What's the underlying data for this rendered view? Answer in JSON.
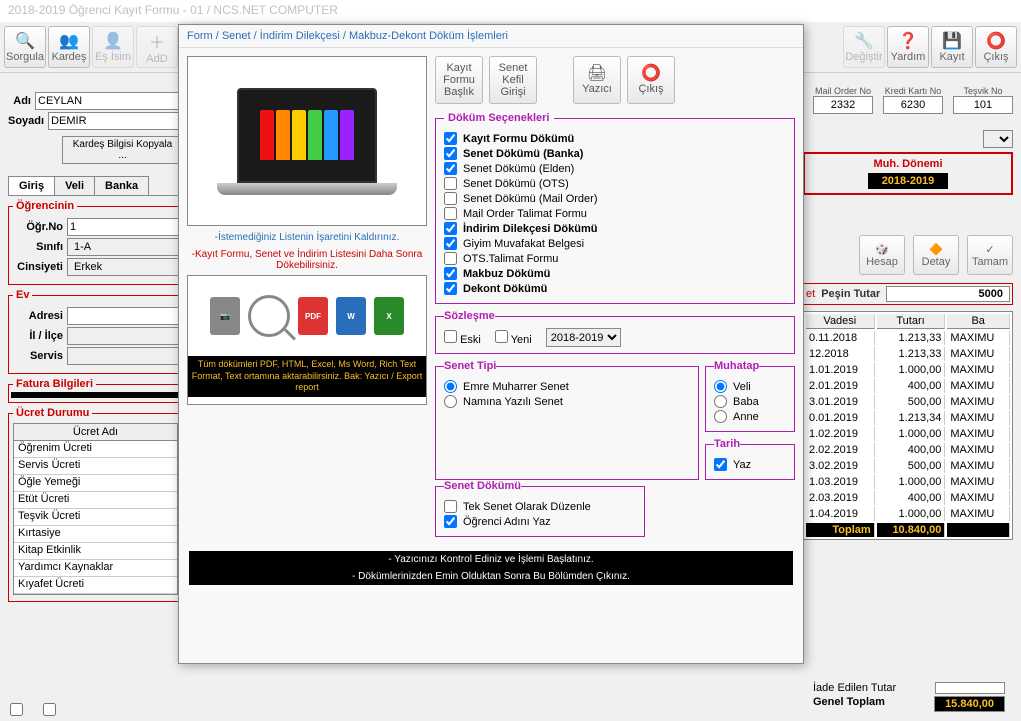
{
  "window_title": "2018-2019 Öğrenci Kayıt Formu - 01 / NCS.NET COMPUTER",
  "main_toolbar": [
    "Sorgula",
    "Kardeş",
    "Eş İsim",
    "AdD",
    "",
    "Değiştir",
    "Yardım",
    "Kayıt",
    "Çıkış"
  ],
  "main_toolbar_icons": [
    "🔍",
    "👥",
    "👤",
    "+",
    "",
    "🔧",
    "❓",
    "💾",
    "⭕"
  ],
  "form": {
    "adi_label": "Adı",
    "adi": "CEYLAN",
    "soyadi_label": "Soyadı",
    "soyadi": "DEMİR",
    "kardes_btn": "Kardeş Bilgisi Kopyala ...",
    "tabs": [
      "Giriş",
      "Veli",
      "Banka"
    ],
    "ogrencinin": "Öğrencinin",
    "ogr_no_label": "Öğr.No",
    "ogr_no": "1",
    "sinifi_label": "Sınıfı",
    "sinifi": "1-A",
    "cinsiyeti_label": "Cinsiyeti",
    "cinsiyeti": "Erkek",
    "ev": "Ev",
    "adresi": "Adresi",
    "il_ilce": "İl / İlçe",
    "servis": "Servis",
    "fatura": "Fatura Bilgileri",
    "ucret_durumu": "Ücret Durumu",
    "ucret_header": "Ücret Adı",
    "ucret_list": [
      "Öğrenim Ücreti",
      "Servis Ücreti",
      "Öğle Yemeği",
      "Etüt Ücreti",
      "Teşvik Ücreti",
      "Kırtasiye",
      "Kitap Etkinlik",
      "Yardımcı Kaynaklar",
      "Kıyafet Ücreti"
    ]
  },
  "top_right": {
    "mail_order_label": "Mail Order No",
    "mail_order": "2332",
    "kredi_label": "Kredi Kartı No",
    "kredi": "6230",
    "tesvik_label": "Teşvik No",
    "tesvik": "101",
    "muh_donemi_label": "Muh. Dönemi",
    "muh_donemi": "2018-2019",
    "hesap": "Hesap",
    "detay": "Detay",
    "tamam": "Tamam",
    "pesin_label": "Peşin Tutar",
    "pesin": "5000"
  },
  "table": {
    "headers": [
      "Vadesi",
      "Tutarı",
      "Ba"
    ],
    "rows": [
      [
        "0.11.2018",
        "1.213,33",
        "MAXIMU"
      ],
      [
        "12.2018",
        "1.213,33",
        "MAXIMU"
      ],
      [
        "1.01.2019",
        "1.000,00",
        "MAXIMU"
      ],
      [
        "2.01.2019",
        "400,00",
        "MAXIMU"
      ],
      [
        "3.01.2019",
        "500,00",
        "MAXIMU"
      ],
      [
        "0.01.2019",
        "1.213,34",
        "MAXIMU"
      ],
      [
        "1.02.2019",
        "1.000,00",
        "MAXIMU"
      ],
      [
        "2.02.2019",
        "400,00",
        "MAXIMU"
      ],
      [
        "3.02.2019",
        "500,00",
        "MAXIMU"
      ],
      [
        "1.03.2019",
        "1.000,00",
        "MAXIMU"
      ],
      [
        "2.03.2019",
        "400,00",
        "MAXIMU"
      ],
      [
        "1.04.2019",
        "1.000,00",
        "MAXIMU"
      ]
    ],
    "total_label": "Toplam",
    "total": "10.840,00",
    "iade_label": "İade Edilen Tutar",
    "genel_label": "Genel Toplam",
    "genel": "15.840,00"
  },
  "modal": {
    "title": "Form / Senet / İndirim Dilekçesi / Makbuz-Dekont Döküm İşlemleri",
    "btns": [
      {
        "l1": "Kayıt",
        "l2": "Formu",
        "l3": "Başlık"
      },
      {
        "l1": "Senet",
        "l2": "Kefil",
        "l3": "Girişi"
      },
      {
        "l1": "",
        "l2": "Yazıcı",
        "l3": "",
        "ic": "🖨"
      },
      {
        "l1": "",
        "l2": "Çıkış",
        "l3": "",
        "ic": "⭕"
      }
    ],
    "note_blue": "-İstemediğiniz Listenin İşaretini Kaldırınız.",
    "note_red": "-Kayıt Formu, Senet ve İndirim Listesini Daha Sonra Dökebilirsiniz.",
    "caption": "Tüm dökümleri PDF, HTML, Excel, Ms Word, Rich Text Format, Text ortamına aktarabilirsiniz. Bak: Yazıcı / Export report",
    "dokum_label": "Döküm Seçenekleri",
    "dokum": [
      {
        "t": "Kayıt Formu Dökümü",
        "c": true,
        "b": true
      },
      {
        "t": "Senet Dökümü (Banka)",
        "c": true,
        "b": true
      },
      {
        "t": "Senet Dökümü (Elden)",
        "c": true,
        "b": false
      },
      {
        "t": "Senet Dökümü (OTS)",
        "c": false,
        "b": false
      },
      {
        "t": "Senet Dökümü (Mail Order)",
        "c": false,
        "b": false
      },
      {
        "t": "Mail Order Talimat Formu",
        "c": false,
        "b": false
      },
      {
        "t": "İndirim Dilekçesi Dökümü",
        "c": true,
        "b": true
      },
      {
        "t": "Giyim Muvafakat Belgesi",
        "c": true,
        "b": false
      },
      {
        "t": "OTS.Talimat Formu",
        "c": false,
        "b": false
      },
      {
        "t": "Makbuz Dökümü",
        "c": true,
        "b": true
      },
      {
        "t": "Dekont Dökümü",
        "c": true,
        "b": true
      }
    ],
    "sozlesme_label": "Sözleşme",
    "eski": "Eski",
    "yeni": "Yeni",
    "donem": "2018-2019",
    "senet_tipi_label": "Senet Tipi",
    "senet_tipi": [
      "Emre Muharrer Senet",
      "Namına Yazılı Senet"
    ],
    "muhatap_label": "Muhatap",
    "muhatap": [
      "Veli",
      "Baba",
      "Anne"
    ],
    "tarih_label": "Tarih",
    "yaz": "Yaz",
    "senet_dokumu_label": "Senet Dökümü",
    "senet_dokumu": [
      {
        "t": "Tek Senet Olarak Düzenle",
        "c": false
      },
      {
        "t": "Öğrenci Adını Yaz",
        "c": true
      }
    ],
    "strip1": "- Yazıcınızı Kontrol Ediniz ve İşlemi Başlatınız.",
    "strip2": "- Dökümlerinizden Emin Olduktan Sonra Bu Bölümden Çıkınız."
  }
}
